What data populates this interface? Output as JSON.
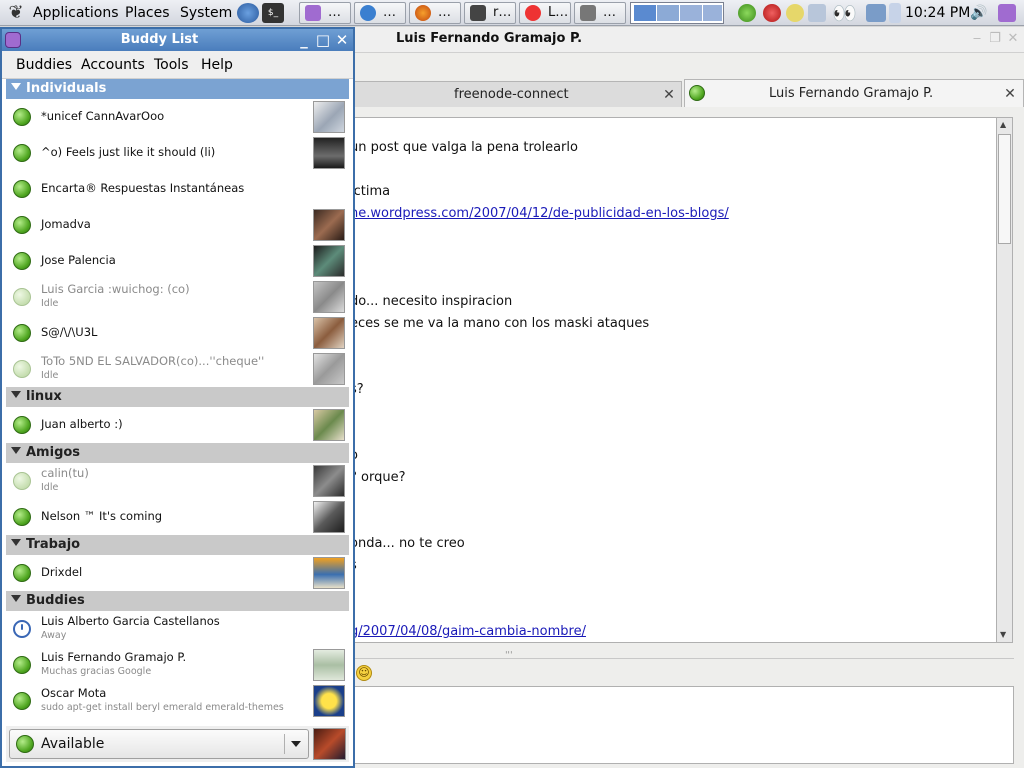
{
  "panel": {
    "menus": [
      "Applications",
      "Places",
      "System"
    ],
    "taskbar": [
      {
        "label": "…",
        "icon": "pidgin-icon"
      },
      {
        "label": "…",
        "icon": "xchat-icon"
      },
      {
        "label": "…",
        "icon": "firefox-icon"
      },
      {
        "label": "r…",
        "icon": "terminal-icon"
      },
      {
        "label": "L…",
        "icon": "chat-icon"
      },
      {
        "label": "…",
        "icon": "camera-icon"
      }
    ],
    "clock": "10:24 PM"
  },
  "conversation": {
    "title": "Luis Fernando Gramajo P.",
    "tabs": [
      {
        "label": "freenode-connect"
      },
      {
        "label": "Luis Fernando Gramajo P."
      }
    ],
    "lines": [
      {
        "text": "un post que valga la pena trolearlo",
        "link": false
      },
      {
        "text": "ictima",
        "link": false
      },
      {
        "text": "ne.wordpress.com/2007/04/12/de-publicidad-en-los-blogs/",
        "link": true
      },
      {
        "text": "do... necesito inspiracion",
        "link": false
      },
      {
        "text": "eces se me va la mano con los maski ataques",
        "link": false
      },
      {
        "text": "s?",
        "link": false
      },
      {
        "text": "o",
        "link": false
      },
      {
        "text": "? orque?",
        "link": false
      },
      {
        "text": "onda... no te creo",
        "link": false
      },
      {
        "text": "s",
        "link": false
      },
      {
        "text": "g/2007/04/08/gaim-cambia-nombre/",
        "link": true
      }
    ]
  },
  "buddy_list": {
    "title": "Buddy List",
    "menu": [
      "Buddies",
      "Accounts",
      "Tools",
      "Help"
    ],
    "groups": [
      {
        "name": "Individuals",
        "buddies": [
          {
            "name": "*unicef CannAvarOoo",
            "status": "",
            "state": "available"
          },
          {
            "name": "^o)  Feels just like it should (li)",
            "status": "",
            "state": "available"
          },
          {
            "name": "Encarta® Respuestas Instantáneas",
            "status": "",
            "state": "available"
          },
          {
            "name": "Jomadva",
            "status": "",
            "state": "available"
          },
          {
            "name": "Jose Palencia",
            "status": "",
            "state": "available"
          },
          {
            "name": "Luis Garcia :wuichog: (co)",
            "status": "Idle",
            "state": "idle"
          },
          {
            "name": "S@/\\/\\U3L",
            "status": "",
            "state": "available"
          },
          {
            "name": "ToTo 5ND EL SALVADOR(co)...''cheque''",
            "status": "Idle",
            "state": "idle"
          }
        ]
      },
      {
        "name": "linux",
        "buddies": [
          {
            "name": "Juan alberto :)",
            "status": "",
            "state": "available"
          }
        ]
      },
      {
        "name": "Amigos",
        "buddies": [
          {
            "name": "calin(tu)",
            "status": "Idle",
            "state": "idle"
          },
          {
            "name": "Nelson ™ It's coming",
            "status": "",
            "state": "available"
          }
        ]
      },
      {
        "name": "Trabajo",
        "buddies": [
          {
            "name": "Drixdel",
            "status": "",
            "state": "available"
          }
        ]
      },
      {
        "name": "Buddies",
        "buddies": [
          {
            "name": "Luis Alberto Garcia Castellanos",
            "status": "Away",
            "state": "away"
          },
          {
            "name": "Luis Fernando Gramajo P.",
            "status": "Muchas gracias Google",
            "state": "available"
          },
          {
            "name": "Oscar Mota",
            "status": "sudo apt-get install beryl emerald emerald-themes",
            "state": "available"
          }
        ]
      }
    ],
    "status_selector": "Available"
  }
}
